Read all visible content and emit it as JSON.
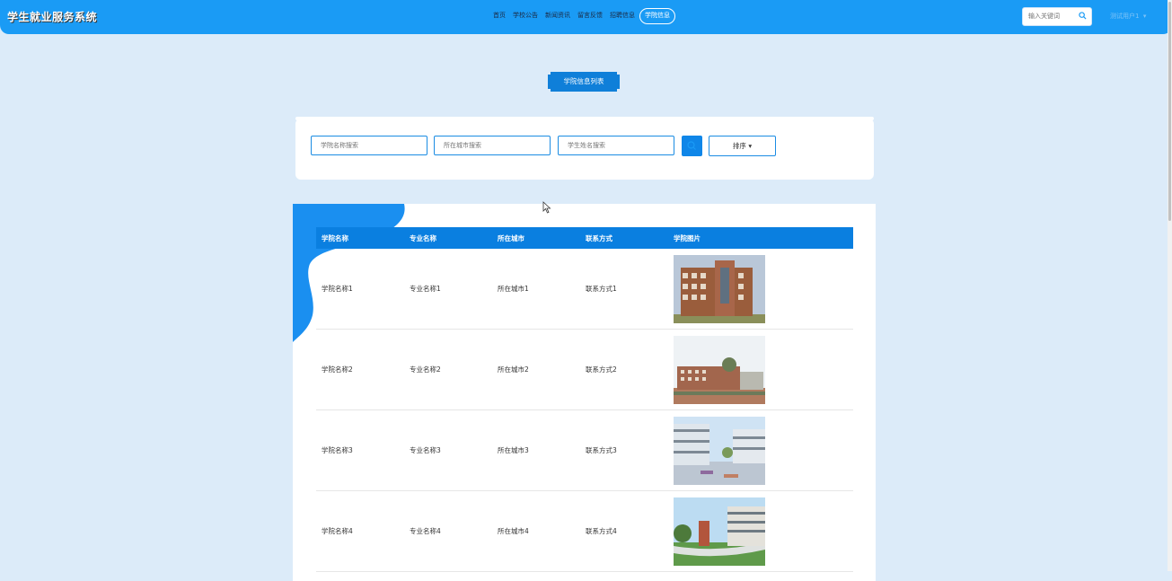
{
  "app": {
    "title": "学生就业服务系统"
  },
  "nav": [
    {
      "label": "首页",
      "active": false
    },
    {
      "label": "学校公告",
      "active": false
    },
    {
      "label": "新闻资讯",
      "active": false
    },
    {
      "label": "留言反馈",
      "active": false
    },
    {
      "label": "招聘信息",
      "active": false
    },
    {
      "label": "学院信息",
      "active": true
    }
  ],
  "header_search": {
    "placeholder": "输入关键词",
    "icon": "search-icon"
  },
  "user": {
    "label": "测试用户1",
    "icon": "chevron-down-icon"
  },
  "page_title": "学院信息列表",
  "filters": {
    "college_placeholder": "学院名称搜索",
    "city_placeholder": "所在城市搜索",
    "student_placeholder": "学生姓名搜索",
    "search_icon": "search-icon",
    "sort_label": "排序",
    "sort_icon": "caret-down-icon"
  },
  "table": {
    "headers": [
      "学院名称",
      "专业名称",
      "所在城市",
      "联系方式",
      "学院图片"
    ],
    "rows": [
      {
        "college": "学院名称1",
        "major": "专业名称1",
        "city": "所在城市1",
        "contact": "联系方式1"
      },
      {
        "college": "学院名称2",
        "major": "专业名称2",
        "city": "所在城市2",
        "contact": "联系方式2"
      },
      {
        "college": "学院名称3",
        "major": "专业名称3",
        "city": "所在城市3",
        "contact": "联系方式3"
      },
      {
        "college": "学院名称4",
        "major": "专业名称4",
        "city": "所在城市4",
        "contact": "联系方式4"
      }
    ]
  },
  "colors": {
    "header_bg": "#1a9bf5",
    "page_bg": "#dcebf9",
    "accent": "#0a7fe0"
  }
}
